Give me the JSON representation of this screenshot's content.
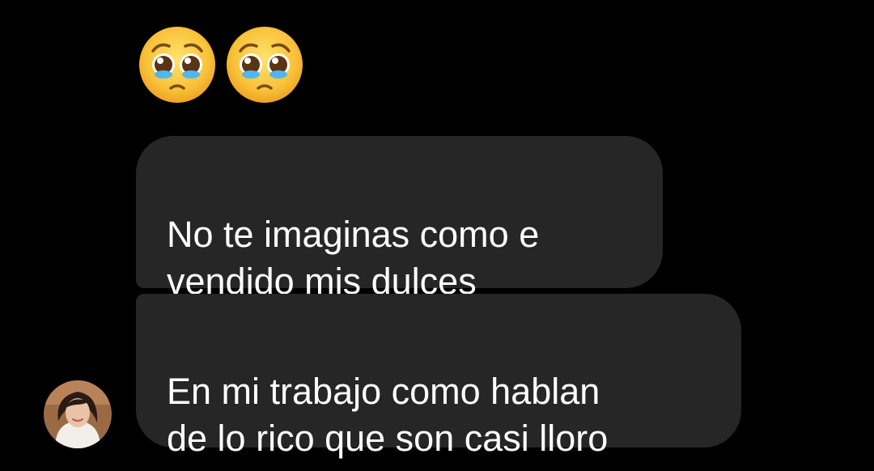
{
  "messages": [
    {
      "type": "emoji",
      "emojis": [
        "pleading-face-emoji",
        "pleading-face-emoji"
      ]
    },
    {
      "type": "text",
      "text": "No te imaginas como e\nvendido mis dulces"
    },
    {
      "type": "text",
      "text": "En mi trabajo como hablan\nde lo rico que son casi lloro"
    }
  ],
  "colors": {
    "background": "#000000",
    "bubble": "#262626",
    "text": "#ffffff"
  }
}
